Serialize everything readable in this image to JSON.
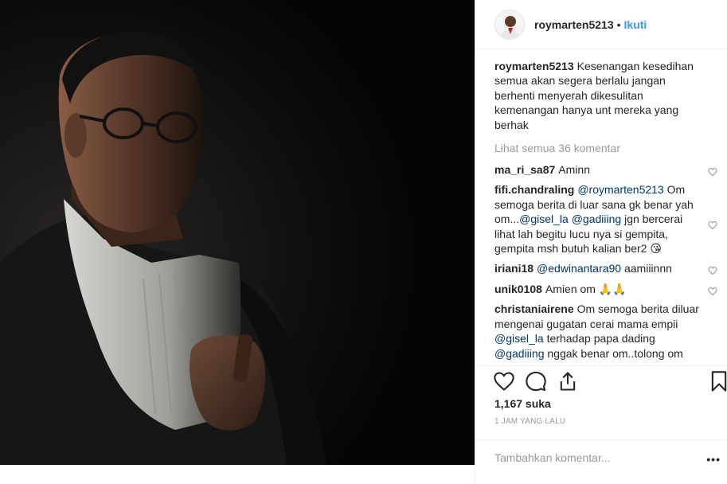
{
  "post": {
    "photo_alt": "post-photo",
    "username": "roymarten5213",
    "separator": "•",
    "follow_label": "Ikuti"
  },
  "caption": {
    "username": "roymarten5213",
    "text": "Kesenangan kesedihan semua akan segera berlalu jangan berhenti menyerah dikesulitan kemenangan hanya unt mereka yang berhak"
  },
  "view_all_label": "Lihat semua 36 komentar",
  "comments": [
    {
      "username": "ma_ri_sa87",
      "parts": [
        {
          "t": "Aminn",
          "m": false
        }
      ]
    },
    {
      "username": "fifi.chandraling",
      "parts": [
        {
          "t": "@roymarten5213",
          "m": true
        },
        {
          "t": " Om semoga berita di luar sana gk benar yah om...",
          "m": false
        },
        {
          "t": "@gisel_la",
          "m": true
        },
        {
          "t": " ",
          "m": false
        },
        {
          "t": "@gadiiing",
          "m": true
        },
        {
          "t": " jgn bercerai lihat lah begitu lucu nya si gempita, gempita msh butuh kalian ber2 😘",
          "m": false
        }
      ]
    },
    {
      "username": "iriani18",
      "parts": [
        {
          "t": "@edwinantara90",
          "m": true
        },
        {
          "t": " aamiiinnn",
          "m": false
        }
      ]
    },
    {
      "username": "unik0108",
      "parts": [
        {
          "t": "Amien om 🙏🙏",
          "m": false
        }
      ]
    },
    {
      "username": "christaniairene",
      "parts": [
        {
          "t": "Om semoga berita diluar mengenai gugatan cerai mama empii ",
          "m": false
        },
        {
          "t": "@gisel_la",
          "m": true
        },
        {
          "t": " terhadap papa dading ",
          "m": false
        },
        {
          "t": "@gadiiing",
          "m": true
        },
        {
          "t": " nggak benar om..tolong om",
          "m": false
        }
      ]
    }
  ],
  "likes_label": "1,167 suka",
  "time_label": "1 JAM YANG LALU",
  "add_comment_placeholder": "Tambahkan komentar...",
  "more_label": "•••",
  "icons": {
    "like": "heart-icon",
    "comment": "comment-icon",
    "share": "share-icon",
    "save": "bookmark-icon"
  },
  "colors": {
    "link": "#3897f0",
    "mention": "#003569",
    "muted": "#999999"
  }
}
